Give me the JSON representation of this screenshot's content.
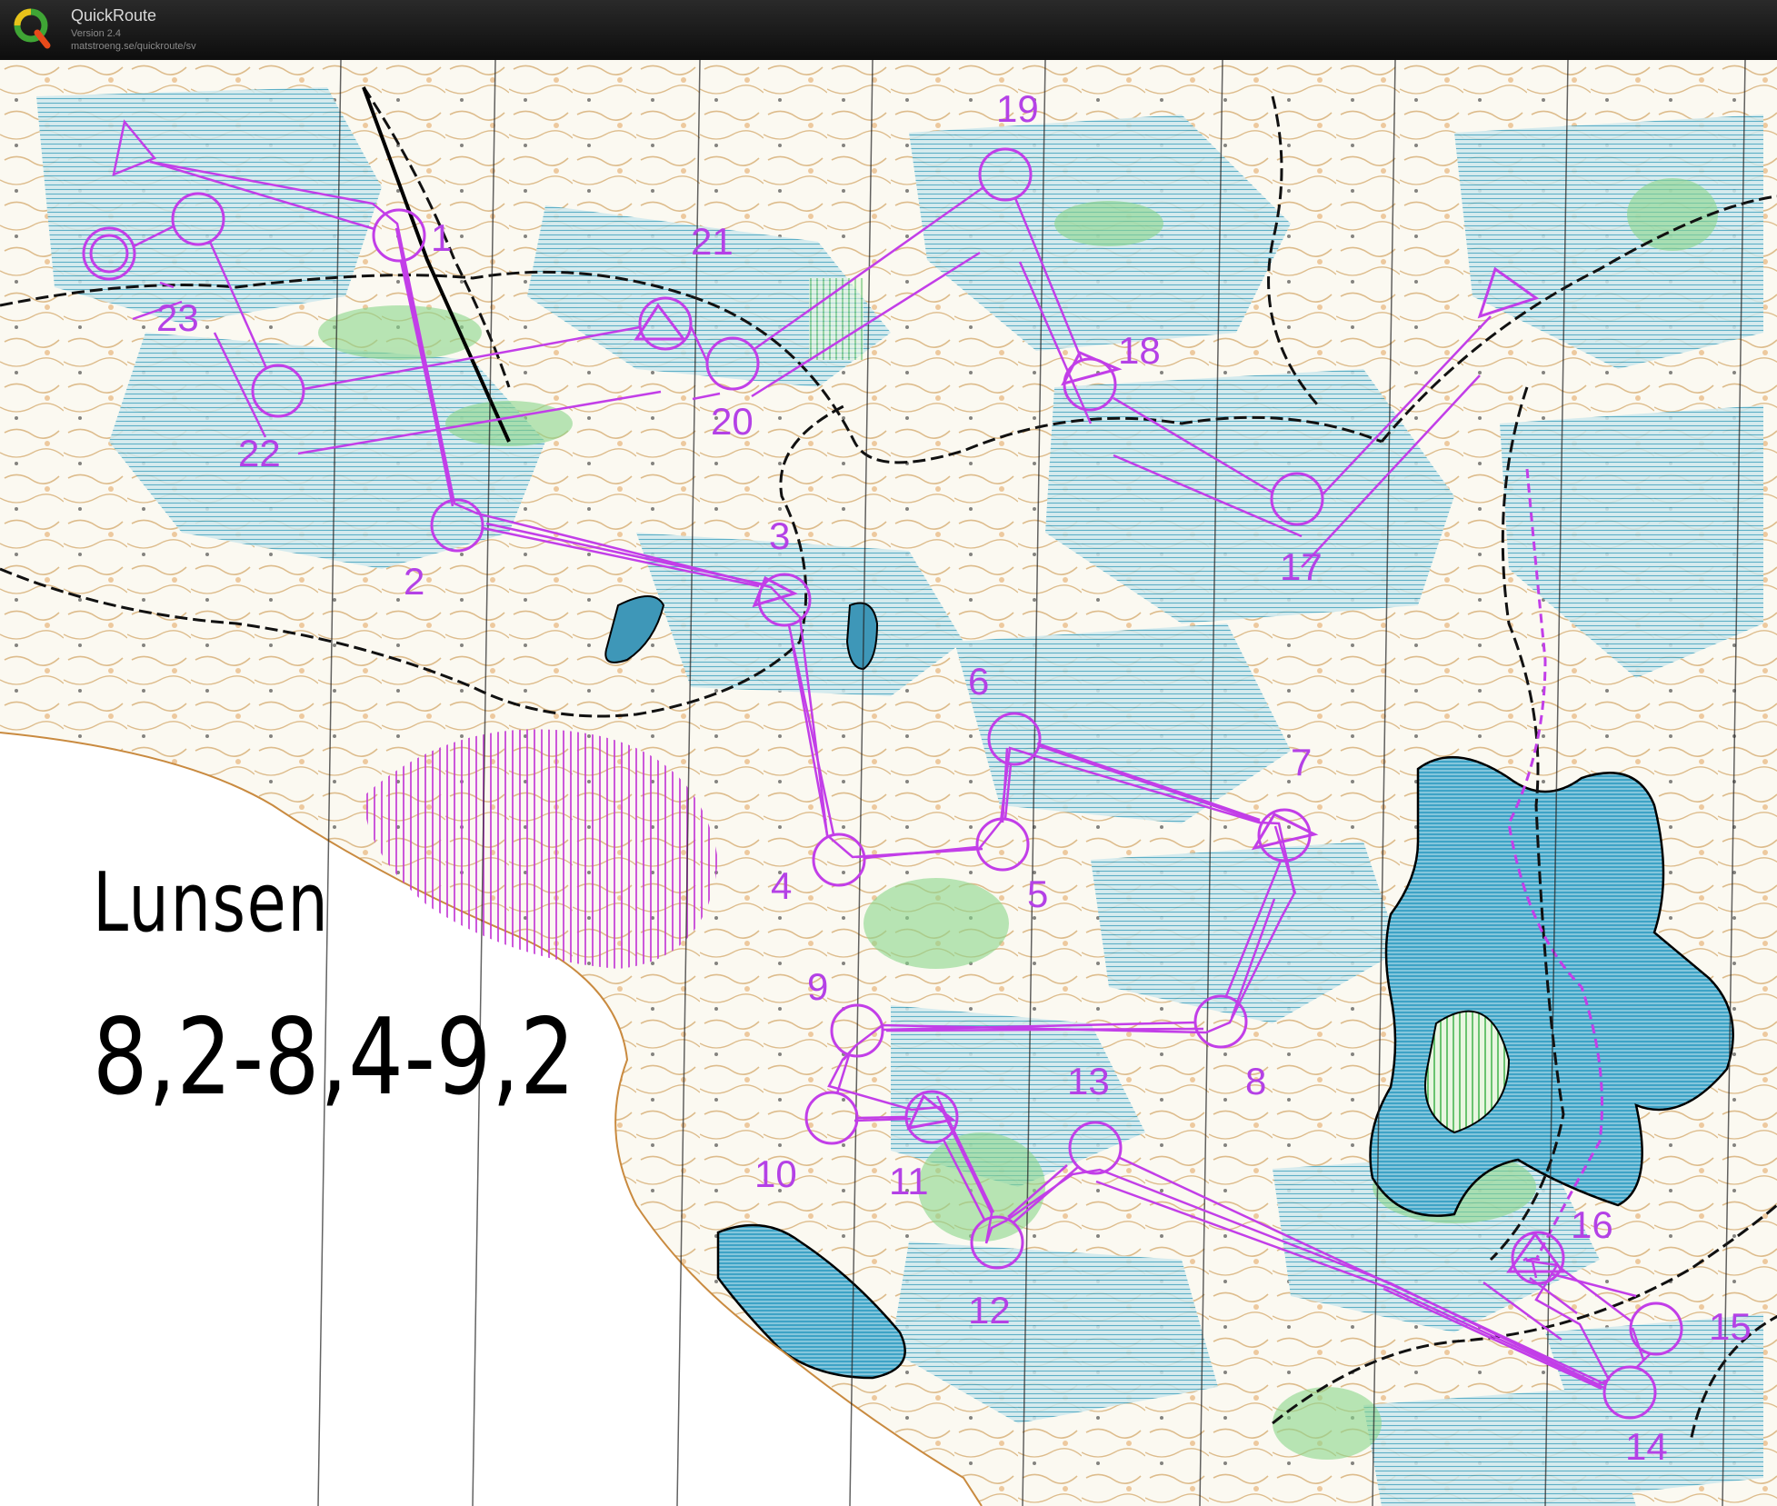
{
  "app": {
    "title": "QuickRoute",
    "version": "Version 2.4",
    "url": "matstroeng.se/quickroute/sv"
  },
  "map": {
    "event_name": "Lunsen",
    "course_lengths": "8,2-8,4-9,2",
    "course_color": "#c23ee8",
    "controls": [
      {
        "label": "1"
      },
      {
        "label": "2"
      },
      {
        "label": "3"
      },
      {
        "label": "4"
      },
      {
        "label": "5"
      },
      {
        "label": "6"
      },
      {
        "label": "7"
      },
      {
        "label": "8"
      },
      {
        "label": "9"
      },
      {
        "label": "10"
      },
      {
        "label": "11"
      },
      {
        "label": "12"
      },
      {
        "label": "13"
      },
      {
        "label": "14"
      },
      {
        "label": "15"
      },
      {
        "label": "16"
      },
      {
        "label": "17"
      },
      {
        "label": "18"
      },
      {
        "label": "19"
      },
      {
        "label": "20"
      },
      {
        "label": "21"
      },
      {
        "label": "22"
      },
      {
        "label": "23"
      }
    ]
  }
}
